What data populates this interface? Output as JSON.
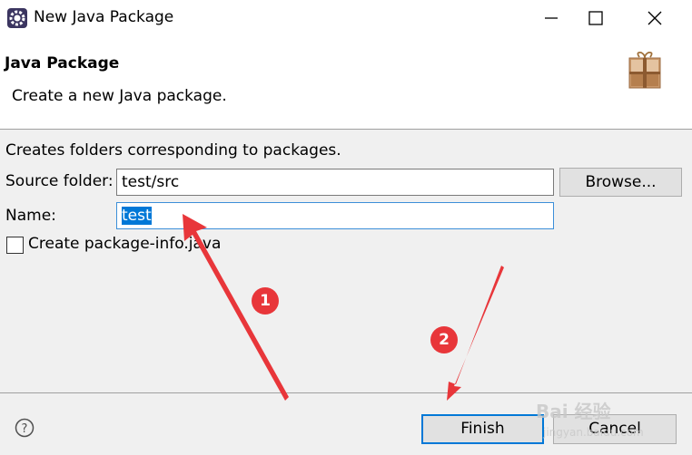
{
  "window": {
    "title": "New Java Package",
    "icons": {
      "app": "eclipse-icon",
      "minimize": "minimize-icon",
      "maximize": "maximize-icon",
      "close": "close-icon"
    }
  },
  "header": {
    "title": "Java Package",
    "description": "Create a new Java package.",
    "icon": "package-icon"
  },
  "form": {
    "intro": "Creates folders corresponding to packages.",
    "source_folder": {
      "label": "Source folder:",
      "value": "test/src",
      "browse_label": "Browse..."
    },
    "name": {
      "label": "Name:",
      "value": "test"
    },
    "package_info": {
      "label": "Create package-info.java",
      "checked": false
    }
  },
  "footer": {
    "help_icon": "help-icon",
    "finish_label": "Finish",
    "cancel_label": "Cancel"
  },
  "annotations": {
    "step1": "1",
    "step2": "2",
    "arrow_color": "#e8363a",
    "watermark": "Bai 经验",
    "watermark_url": "jingyan.baidu.com"
  },
  "colors": {
    "accent": "#0078d7",
    "annotation": "#e8363a"
  }
}
